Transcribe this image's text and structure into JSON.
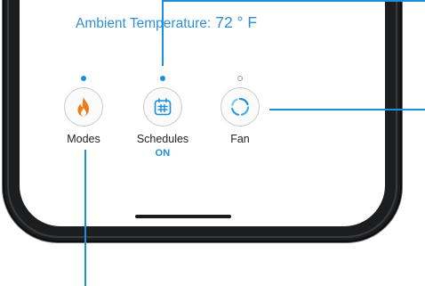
{
  "ambient": {
    "label": "Ambient Temperature:",
    "value": "72 ° F"
  },
  "controls": [
    {
      "label": "Modes",
      "status": "",
      "indicator_active": true,
      "icon": "flame-icon"
    },
    {
      "label": "Schedules",
      "status": "ON",
      "indicator_active": true,
      "icon": "calendar-grid-icon"
    },
    {
      "label": "Fan",
      "status": "",
      "indicator_active": false,
      "icon": "fan-icon"
    }
  ],
  "colors": {
    "accent": "#1a8fe0",
    "flame": "#f07a1a",
    "ambient_text": "#2f8fd6",
    "bezel": "#1c1d1f"
  }
}
